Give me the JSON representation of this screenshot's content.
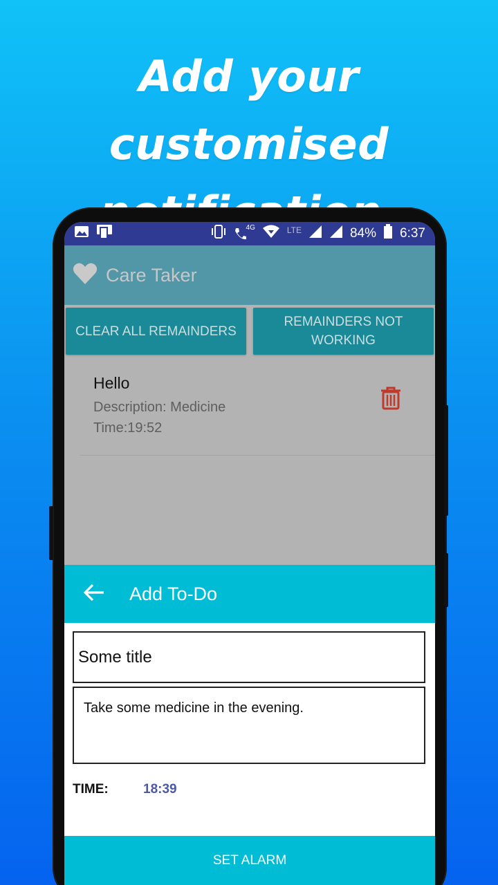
{
  "promo": {
    "line1": "Add your customised",
    "line2": "notification."
  },
  "status_bar": {
    "net_4g": "4G",
    "net_lte": "LTE",
    "battery": "84%",
    "time": "6:37"
  },
  "app": {
    "title": "Care Taker"
  },
  "buttons": {
    "clear_all": "CLEAR ALL REMAINDERS",
    "not_working": "REMAINDERS NOT WORKING"
  },
  "reminders": [
    {
      "title": "Hello",
      "description": "Description: Medicine",
      "time": "Time:19:52"
    }
  ],
  "add_todo": {
    "title": "Add To-Do",
    "title_value": "Some title",
    "description_value": "Take some medicine in the evening.",
    "time_label": "TIME:",
    "time_value": "18:39",
    "set_alarm": "SET ALARM"
  },
  "colors": {
    "app_bar": "#5297a8",
    "button": "#1b8a98",
    "sheet_bar": "#00bcd4",
    "status_bar": "#2f3a93",
    "delete": "#c0392b"
  },
  "icons": [
    "image-icon",
    "screencast-icon",
    "vibrate-icon",
    "wifi-call-icon",
    "wifi-icon",
    "signal-icon",
    "battery-icon",
    "heart-icon",
    "trash-icon",
    "back-arrow-icon"
  ]
}
